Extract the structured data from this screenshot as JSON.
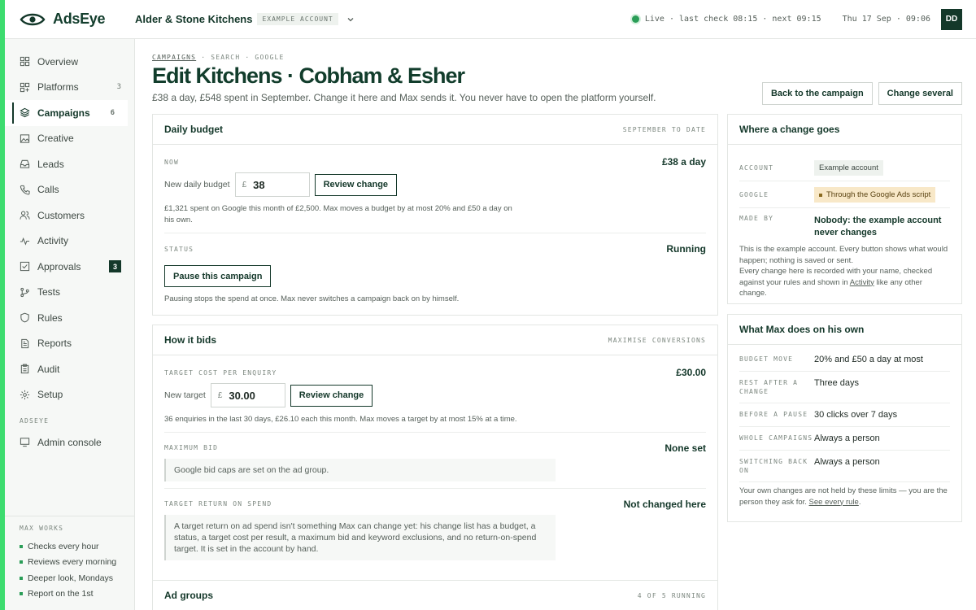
{
  "brand": {
    "name": "AdsEye",
    "accent": "#3ddc6f",
    "dark": "#14382a"
  },
  "header": {
    "account_name": "Alder & Stone Kitchens",
    "account_tag": "EXAMPLE ACCOUNT",
    "status": "Live · last check 08:15 · next 09:15",
    "datetime": "Thu 17 Sep · 09:06",
    "user_initials": "DD"
  },
  "sidebar": {
    "items": [
      {
        "label": "Overview",
        "icon": "grid-icon"
      },
      {
        "label": "Platforms",
        "icon": "platforms-icon",
        "count": "3"
      },
      {
        "label": "Campaigns",
        "icon": "layers-icon",
        "count": "6",
        "active": true
      },
      {
        "label": "Creative",
        "icon": "image-icon"
      },
      {
        "label": "Leads",
        "icon": "inbox-icon"
      },
      {
        "label": "Calls",
        "icon": "phone-icon"
      },
      {
        "label": "Customers",
        "icon": "users-icon"
      },
      {
        "label": "Activity",
        "icon": "activity-icon"
      },
      {
        "label": "Approvals",
        "icon": "check-square-icon",
        "badge": "3"
      },
      {
        "label": "Tests",
        "icon": "branch-icon"
      },
      {
        "label": "Rules",
        "icon": "shield-icon"
      },
      {
        "label": "Reports",
        "icon": "report-icon"
      },
      {
        "label": "Audit",
        "icon": "clipboard-icon"
      },
      {
        "label": "Setup",
        "icon": "settings-icon"
      }
    ],
    "section_label": "ADSEYE",
    "admin": {
      "label": "Admin console",
      "icon": "console-icon"
    },
    "max_works": {
      "label": "MAX WORKS",
      "items": [
        "Checks every hour",
        "Reviews every morning",
        "Deeper look, Mondays",
        "Report on the 1st"
      ]
    }
  },
  "page": {
    "crumbs": [
      "CAMPAIGNS",
      "SEARCH",
      "GOOGLE"
    ],
    "title": "Edit Kitchens · Cobham & Esher",
    "subtitle": "£38 a day, £548 spent in September. Change it here and Max sends it. You never have to open the platform yourself.",
    "back_button": "Back to the campaign",
    "change_several_button": "Change several"
  },
  "budget_card": {
    "title": "Daily budget",
    "meta": "SEPTEMBER TO DATE",
    "now_label": "NOW",
    "now_value": "£38 a day",
    "input_label": "New daily budget",
    "currency": "£",
    "input_value": "38",
    "review_button": "Review change",
    "note": "£1,321 spent on Google this month of £2,500. Max moves a budget by at most 20% and £50 a day on his own.",
    "status_label": "STATUS",
    "status_value": "Running",
    "pause_button": "Pause this campaign",
    "pause_note": "Pausing stops the spend at once. Max never switches a campaign back on by himself."
  },
  "bids_card": {
    "title": "How it bids",
    "meta": "MAXIMISE CONVERSIONS",
    "target_label": "TARGET COST PER ENQUIRY",
    "target_value": "£30.00",
    "input_label": "New target",
    "currency": "£",
    "input_value": "30.00",
    "review_button": "Review change",
    "note": "36 enquiries in the last 30 days, £26.10 each this month. Max moves a target by at most 15% at a time.",
    "max_bid_label": "MAXIMUM BID",
    "max_bid_value": "None set",
    "max_bid_note": "Google bid caps are set on the ad group.",
    "roas_label": "TARGET RETURN ON SPEND",
    "roas_value": "Not changed here",
    "roas_note": "A target return on ad spend isn't something Max can change yet: his change list has a budget, a status, a target cost per result, a maximum bid and keyword exclusions, and no return-on-spend target. It is set in the account by hand."
  },
  "adgroups_card": {
    "title": "Ad groups",
    "meta": "4 OF 5 RUNNING"
  },
  "where_card": {
    "title": "Where a change goes",
    "account_label": "ACCOUNT",
    "account_value": "Example account",
    "google_label": "GOOGLE",
    "google_value": "Through the Google Ads script",
    "madeby_label": "MADE BY",
    "madeby_value": "Nobody: the example account never changes",
    "note1": "This is the example account. Every button shows what would happen; nothing is saved or sent.",
    "note2_pre": "Every change here is recorded with your name, checked against your rules and shown in ",
    "note2_link": "Activity",
    "note2_post": " like any other change."
  },
  "own_card": {
    "title": "What Max does on his own",
    "rows": [
      {
        "k": "BUDGET MOVE",
        "v": "20% and £50 a day at most"
      },
      {
        "k": "REST AFTER A CHANGE",
        "v": "Three days"
      },
      {
        "k": "BEFORE A PAUSE",
        "v": "30 clicks over 7 days"
      },
      {
        "k": "WHOLE CAMPAIGNS",
        "v": "Always a person"
      },
      {
        "k": "SWITCHING BACK ON",
        "v": "Always a person"
      }
    ],
    "note_pre": "Your own changes are not held by these limits — you are the person they ask for. ",
    "note_link": "See every rule"
  }
}
